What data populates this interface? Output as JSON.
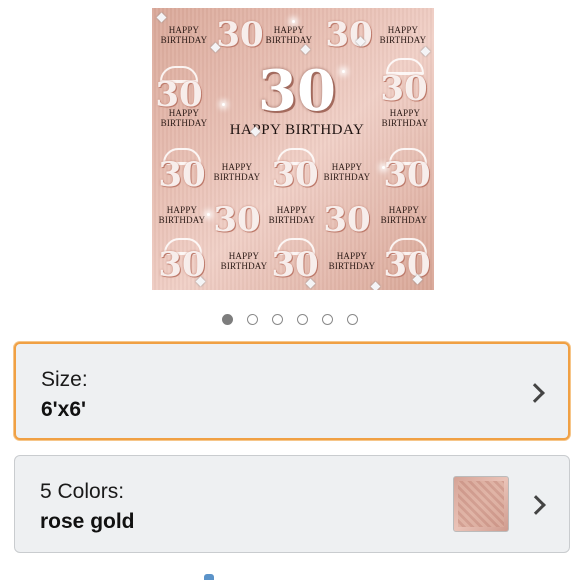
{
  "product_image": {
    "alt": "30 Happy Birthday rose gold backdrop",
    "repeat_text": "HAPPY BIRTHDAY",
    "big_number": "30",
    "small_number": "30",
    "main_text": "HAPPY BIRTHDAY"
  },
  "carousel": {
    "total": 6,
    "active": 0
  },
  "size_option": {
    "label": "Size:",
    "value": "6'x6'"
  },
  "color_option": {
    "label": "5 Colors:",
    "value": "rose gold"
  },
  "colors": {
    "accent": "#f0a044",
    "card_bg": "#eef0f2"
  }
}
